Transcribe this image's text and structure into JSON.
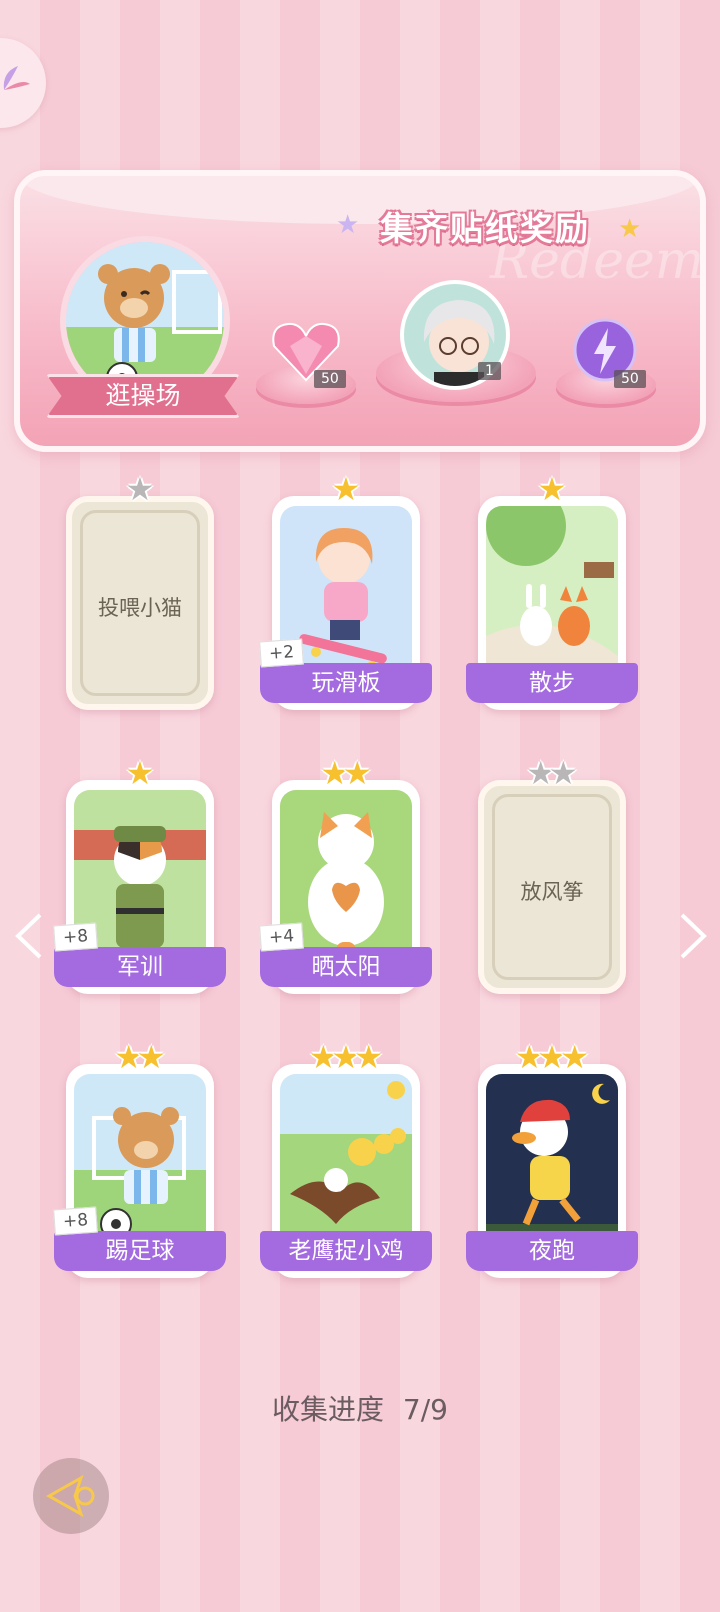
{
  "banner": {
    "title": "集齐贴纸奖励",
    "watermark": "Redeem",
    "main_reward_label": "逛操场",
    "items": [
      {
        "icon": "pink-heart-gem-icon",
        "count": "50"
      },
      {
        "icon": "white-hair-character-avatar-icon",
        "count": "1"
      },
      {
        "icon": "purple-energy-orb-icon",
        "count": "50"
      }
    ]
  },
  "cards": [
    {
      "label": "投喂小猫",
      "stars_total": 1,
      "stars_on": 0,
      "locked": true,
      "bonus": ""
    },
    {
      "label": "玩滑板",
      "stars_total": 1,
      "stars_on": 1,
      "locked": false,
      "bonus": "+2"
    },
    {
      "label": "散步",
      "stars_total": 1,
      "stars_on": 1,
      "locked": false,
      "bonus": ""
    },
    {
      "label": "军训",
      "stars_total": 1,
      "stars_on": 1,
      "locked": false,
      "bonus": "+8"
    },
    {
      "label": "晒太阳",
      "stars_total": 2,
      "stars_on": 2,
      "locked": false,
      "bonus": "+4"
    },
    {
      "label": "放风筝",
      "stars_total": 2,
      "stars_on": 0,
      "locked": true,
      "bonus": ""
    },
    {
      "label": "踢足球",
      "stars_total": 2,
      "stars_on": 2,
      "locked": false,
      "bonus": "+8"
    },
    {
      "label": "老鹰捉小鸡",
      "stars_total": 3,
      "stars_on": 3,
      "locked": false,
      "bonus": ""
    },
    {
      "label": "夜跑",
      "stars_total": 3,
      "stars_on": 3,
      "locked": false,
      "bonus": ""
    }
  ],
  "progress": {
    "label": "收集进度",
    "value": "7/9"
  },
  "colors": {
    "label_purple": "#a46be0",
    "star_gold": "#f6c02f",
    "star_gray": "#b9b6b8",
    "banner_pink": "#f7b9c8"
  }
}
